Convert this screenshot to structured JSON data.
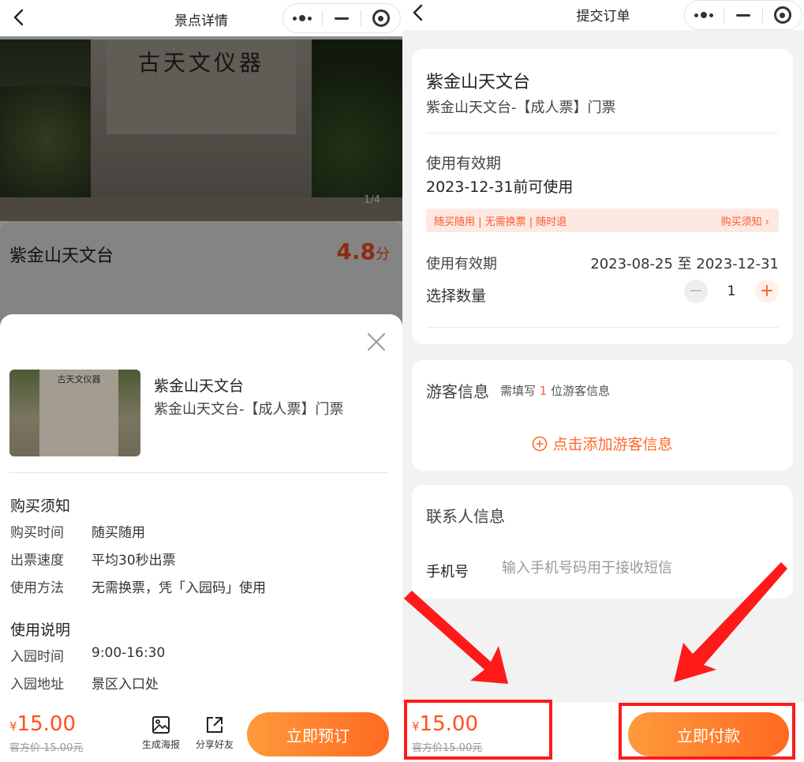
{
  "left": {
    "title": "景点详情",
    "gallery_counter": "1/4",
    "monument_text": "古天文仪器",
    "attraction_name": "紫金山天文台",
    "score": "4.8",
    "score_unit": "分",
    "sheet": {
      "ticket_title": "紫金山天文台",
      "ticket_subtitle": "紫金山天文台-【成人票】门票",
      "purchase_notice": {
        "heading": "购买须知",
        "items": [
          {
            "label": "购买时间",
            "value": "随买随用"
          },
          {
            "label": "出票速度",
            "value": "平均30秒出票"
          },
          {
            "label": "使用方法",
            "value": "无需换票，凭「入园码」使用"
          }
        ]
      },
      "usage_notes": {
        "heading": "使用说明",
        "items": [
          {
            "label": "入园时间",
            "value": "9:00-16:30"
          },
          {
            "label": "入园地址",
            "value": "景区入口处"
          }
        ]
      }
    },
    "bottom": {
      "currency": "¥",
      "price": "15.00",
      "original_price": "官方价 15.00元",
      "poster_label": "生成海报",
      "share_label": "分享好友",
      "book_label": "立即预订"
    }
  },
  "right": {
    "title": "提交订单",
    "ticket": {
      "name": "紫金山天文台",
      "subtitle": "紫金山天文台-【成人票】门票",
      "validity_label": "使用有效期",
      "validity_value": "2023-12-31前可使用",
      "tags": "随买随用 | 无需换票 | 随时退",
      "notice_link": "购买须知 ›",
      "validity_label2": "使用有效期",
      "validity_range": "2023-08-25 至 2023-12-31",
      "quantity_label": "选择数量",
      "quantity_value": "1"
    },
    "guest": {
      "title": "游客信息",
      "hint_prefix": "需填写",
      "hint_count": "1",
      "hint_suffix": "位游客信息",
      "add_label": "点击添加游客信息"
    },
    "contact": {
      "title": "联系人信息",
      "phone_label": "手机号",
      "phone_placeholder": "输入手机号码用于接收短信"
    },
    "bottom": {
      "currency": "¥",
      "price": "15.00",
      "original_price": "官方价15.00元",
      "pay_label": "立即付款"
    }
  },
  "colors": {
    "accent": "#ff6a21",
    "accent_light": "#ff9a3c",
    "price": "#ff4f1f",
    "highlight": "#ff1a1a",
    "tag_bg": "#fde8e2"
  },
  "icons": [
    "back-icon",
    "more-dots-icon",
    "minimize-icon",
    "target-icon",
    "close-icon",
    "poster-icon",
    "share-icon",
    "add-circle-icon",
    "arrow-icon"
  ]
}
